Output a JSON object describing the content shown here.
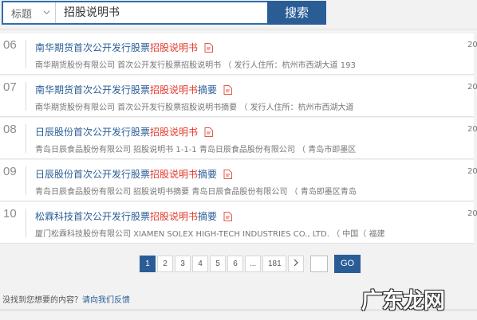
{
  "search": {
    "field_label": "标题",
    "query": "招股说明书",
    "button_label": "搜索"
  },
  "results": [
    {
      "rank": "06",
      "title_pre": "南华期货首次公开发行股票",
      "title_hl": "招股说明书",
      "title_post": "",
      "snippet": "南华期货股份有限公司 首次公开发行股票招股说明书 （ 发行人住所：杭州市西湖大道 193",
      "year": "20"
    },
    {
      "rank": "07",
      "title_pre": "南华期货首次公开发行股票",
      "title_hl": "招股说明书",
      "title_post": "摘要",
      "snippet": "南华期货股份有限公司 首次公开发行股票招股说明书摘要 （ 发行人住所：杭州市西湖大道",
      "year": "20"
    },
    {
      "rank": "08",
      "title_pre": "日辰股份首次公开发行股票",
      "title_hl": "招股说明书",
      "title_post": "",
      "snippet": "青岛日辰食品股份有限公司 招股说明书 1-1-1 青岛日辰食品股份有限公司 （ 青岛市即墨区",
      "year": "20"
    },
    {
      "rank": "09",
      "title_pre": "日辰股份首次公开发行股票",
      "title_hl": "招股说明书",
      "title_post": "摘要",
      "snippet": "青岛日辰食品股份有限公司 招股说明书摘要 青岛日辰食品股份有限公司 （ 青岛即墨区青岛",
      "year": "20"
    },
    {
      "rank": "10",
      "title_pre": "松霖科技首次公开发行股票",
      "title_hl": "招股说明书",
      "title_post": "摘要",
      "snippet": "厦门松霖科技股份有限公司 XIAMEN SOLEX HIGH-TECH INDUSTRIES CO., LTD. （ 中国（ 福建",
      "year": "20"
    }
  ],
  "pagination": {
    "pages": [
      "1",
      "2",
      "3",
      "4",
      "5",
      "6",
      "...",
      "181"
    ],
    "current": "1",
    "next_label": ">",
    "go_label": "GO"
  },
  "footer": {
    "question": "没找到您想要的内容？",
    "link": "请向我们反馈"
  },
  "watermark": {
    "text": "广东龙网"
  },
  "colors": {
    "accent": "#2a5d96",
    "highlight": "#e23b2d"
  }
}
